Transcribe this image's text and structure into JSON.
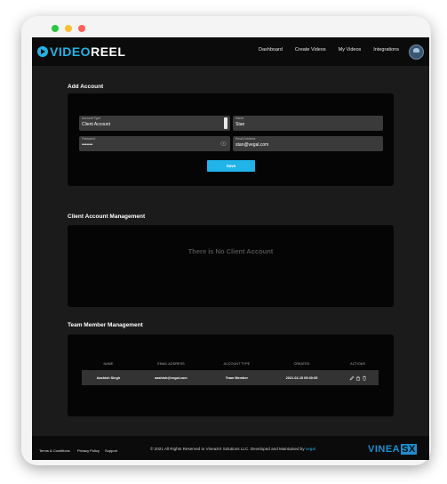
{
  "window": {
    "dot_colors": [
      "#27c93f",
      "#ffbd2e",
      "#ff5f57"
    ]
  },
  "logo": {
    "part1": "VIDEO",
    "part2": "REEL"
  },
  "nav": {
    "items": [
      "Dashboard",
      "Create Videos",
      "My Videos",
      "Integrations"
    ]
  },
  "add_account": {
    "title": "Add Account",
    "account_type": {
      "label": "Account Type",
      "value": "Client Account"
    },
    "name": {
      "label": "Name",
      "value": "Stan"
    },
    "password": {
      "label": "Password",
      "value": "•••••••"
    },
    "email": {
      "label": "Email Address",
      "value": "stan@vegal.com"
    },
    "save_label": "Save"
  },
  "client_mgmt": {
    "title": "Client Account Management",
    "empty_message": "There is No Client Account"
  },
  "team_mgmt": {
    "title": "Team Member Management",
    "columns": [
      "NAME",
      "EMAIL ADDRESS",
      "ACCOUNT TYPE",
      "CREATED",
      "ACTIONS"
    ],
    "rows": [
      {
        "name": "Aashish Singh",
        "email": "aashish@vegal.com",
        "account_type": "Team Member",
        "created": "2021-02-15 05:30:35"
      }
    ]
  },
  "footer": {
    "links": [
      "Terms & Conditions",
      "Privacy Policy",
      "Support"
    ],
    "copyright": "© 2021 All Rights Reserved to VineaSX Solutions LLC. Developed and Maintained by",
    "developer": "vegal",
    "brand_main": "VINEA",
    "brand_box": "SX"
  },
  "colors": {
    "accent": "#21b4e8",
    "background": "#1b1b1b",
    "card": "#050505"
  }
}
